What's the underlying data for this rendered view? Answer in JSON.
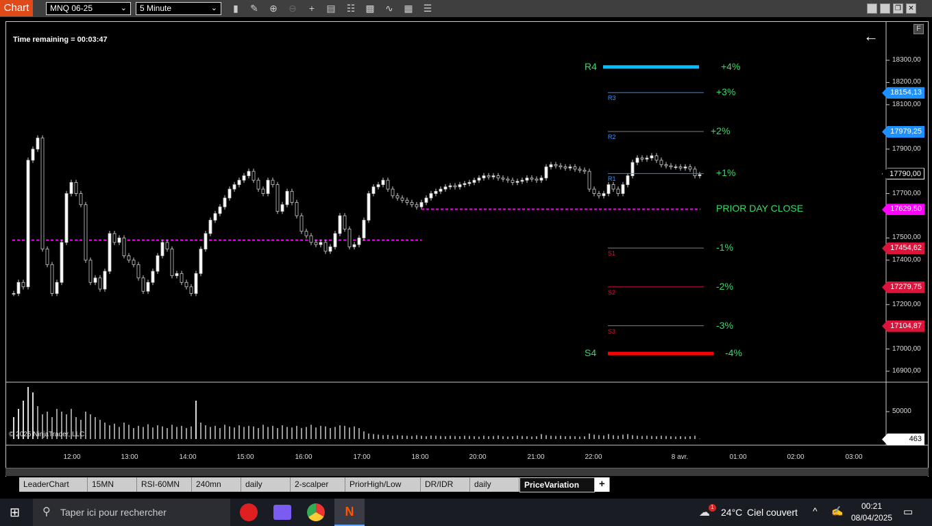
{
  "toolbar": {
    "app_label": "Chart",
    "instrument": "MNQ 06-25",
    "interval": "5 Minute",
    "tools": [
      "bar-type-icon",
      "draw-pencil-icon",
      "zoom-in-icon",
      "zoom-out-icon",
      "crosshair-icon",
      "data-box-icon",
      "chart-trader-icon",
      "properties-icon",
      "indicators-icon",
      "strategies-icon",
      "object-list-icon"
    ]
  },
  "chart": {
    "time_remaining": "Time remaining = 00:03:47",
    "copyright": "© 2025 NinjaTrader, LLC",
    "flag_button": "F",
    "price_ticks": [
      "18300,00",
      "18200,00",
      "18100,00",
      "17900,00",
      "17700,00",
      "17500,00",
      "17400,00",
      "17200,00",
      "17000,00",
      "16900,00"
    ],
    "price_tick_values": [
      18300,
      18200,
      18100,
      17900,
      17700,
      17500,
      17400,
      17200,
      17000,
      16900
    ],
    "volume_tick": "50000",
    "volume_current": "463",
    "time_labels": [
      "12:00",
      "13:00",
      "14:00",
      "15:00",
      "16:00",
      "17:00",
      "18:00",
      "20:00",
      "21:00",
      "22:00",
      "8 avr.",
      "01:00",
      "02:00",
      "03:00"
    ],
    "price_labels": [
      {
        "text": "18154,13",
        "value": 18154.13,
        "color": "#1e90ff"
      },
      {
        "text": "17979,25",
        "value": 17979.25,
        "color": "#1e90ff"
      },
      {
        "text": "17790,00",
        "value": 17790,
        "color": "#000000"
      },
      {
        "text": "17629,50",
        "value": 17629.5,
        "color": "#ff00ff"
      },
      {
        "text": "17454,62",
        "value": 17454.62,
        "color": "#dc143c"
      },
      {
        "text": "17279,75",
        "value": 17279.75,
        "color": "#dc143c"
      },
      {
        "text": "17104,87",
        "value": 17104.87,
        "color": "#dc143c"
      }
    ],
    "levels": [
      {
        "name": "R4",
        "pct": "+4%",
        "value": 18270,
        "color": "#00bfff"
      },
      {
        "name": "R3",
        "pct": "+3%",
        "value": 18154.13,
        "color": "#1e90ff"
      },
      {
        "name": "R2",
        "pct": "+2%",
        "value": 17979.25,
        "color": "#808080"
      },
      {
        "name": "R1",
        "pct": "+1%",
        "value": 17790,
        "color": "#1e90ff"
      },
      {
        "name": "PRIOR DAY CLOSE",
        "value": 17629.5,
        "color": "#ff00ff"
      },
      {
        "name": "S1",
        "pct": "-1%",
        "value": 17454.62,
        "color": "#808080"
      },
      {
        "name": "S2",
        "pct": "-2%",
        "value": 17279.75,
        "color": "#dc143c"
      },
      {
        "name": "S3",
        "pct": "-3%",
        "value": 17104.87,
        "color": "#808080"
      },
      {
        "name": "S4",
        "pct": "-4%",
        "value": 16980,
        "color": "#ff0000"
      }
    ],
    "previous_close": 17490,
    "closes": [
      17250,
      17300,
      17280,
      17850,
      17900,
      17950,
      17450,
      17380,
      17250,
      17300,
      17480,
      17700,
      17750,
      17700,
      17650,
      17400,
      17300,
      17320,
      17270,
      17350,
      17520,
      17480,
      17500,
      17420,
      17400,
      17380,
      17320,
      17260,
      17300,
      17350,
      17420,
      17480,
      17450,
      17330,
      17340,
      17300,
      17280,
      17250,
      17340,
      17450,
      17520,
      17580,
      17610,
      17640,
      17680,
      17720,
      17740,
      17760,
      17780,
      17800,
      17760,
      17720,
      17700,
      17760,
      17740,
      17620,
      17650,
      17710,
      17660,
      17600,
      17530,
      17510,
      17480,
      17470,
      17480,
      17440,
      17460,
      17520,
      17600,
      17540,
      17460,
      17470,
      17500,
      17580,
      17700,
      17730,
      17740,
      17760,
      17720,
      17690,
      17680,
      17670,
      17660,
      17650,
      17640,
      17660,
      17680,
      17700,
      17710,
      17720,
      17730,
      17735,
      17730,
      17740,
      17745,
      17750,
      17760,
      17770,
      17780,
      17775,
      17780,
      17770,
      17765,
      17760,
      17750,
      17755,
      17760,
      17770,
      17765,
      17760,
      17770,
      17820,
      17830,
      17825,
      17820,
      17815,
      17820,
      17810,
      17805,
      17800,
      17720,
      17700,
      17690,
      17700,
      17740,
      17720,
      17700,
      17740,
      17780,
      17840,
      17860,
      17855,
      17860,
      17870,
      17850,
      17830,
      17825,
      17820,
      17820,
      17815,
      17820,
      17810,
      17780,
      17785
    ],
    "volumes": [
      40000,
      55000,
      70000,
      95000,
      85000,
      60000,
      45000,
      50000,
      40000,
      55000,
      50000,
      45000,
      55000,
      40000,
      35000,
      50000,
      45000,
      40000,
      35000,
      30000,
      25000,
      28000,
      22000,
      30000,
      26000,
      20000,
      24000,
      22000,
      27000,
      21000,
      25000,
      23000,
      20000,
      26000,
      22000,
      24000,
      20000,
      23000,
      70000,
      30000,
      25000,
      22000,
      24000,
      20000,
      26000,
      23000,
      21000,
      25000,
      22000,
      24000,
      23000,
      20000,
      26000,
      22000,
      24000,
      20000,
      25000,
      22000,
      21000,
      24000,
      20000,
      22000,
      26000,
      21000,
      24000,
      23000,
      20000,
      22000,
      25000,
      24000,
      21000,
      23000,
      20000,
      14000,
      10000,
      9000,
      8000,
      7000,
      7500,
      6000,
      7000,
      6500,
      6000,
      5500,
      7000,
      6000,
      5000,
      6500,
      6000,
      5500,
      5000,
      6000,
      5500,
      5000,
      6000,
      5500,
      5000,
      4500,
      6000,
      5000,
      5500,
      6500,
      5000,
      4500,
      5000,
      6000,
      5500,
      5000,
      4500,
      5000,
      9000,
      7000,
      6000,
      5500,
      6000,
      5000,
      5500,
      5000,
      4500,
      5000,
      10000,
      8000,
      7000,
      6500,
      9000,
      7000,
      6000,
      8000,
      9000,
      7000,
      6000,
      5500,
      6000,
      5500,
      5000,
      6000,
      5500,
      5000,
      4500,
      5000,
      4500,
      5000,
      6000,
      463
    ]
  },
  "tabs": [
    {
      "label": "LeaderChart"
    },
    {
      "label": "15MN"
    },
    {
      "label": "RSI-60MN"
    },
    {
      "label": "240mn"
    },
    {
      "label": "daily"
    },
    {
      "label": "2-scalper"
    },
    {
      "label": "PriorHigh/Low"
    },
    {
      "label": "DR/IDR"
    },
    {
      "label": "daily"
    },
    {
      "label": "PriceVariation",
      "active": true
    }
  ],
  "add_tab": "+",
  "taskbar": {
    "search_placeholder": "Taper ici pour rechercher",
    "weather_temp": "24°C",
    "weather_text": "Ciel couvert",
    "weather_badge": "1",
    "time": "00:21",
    "date": "08/04/2025"
  }
}
